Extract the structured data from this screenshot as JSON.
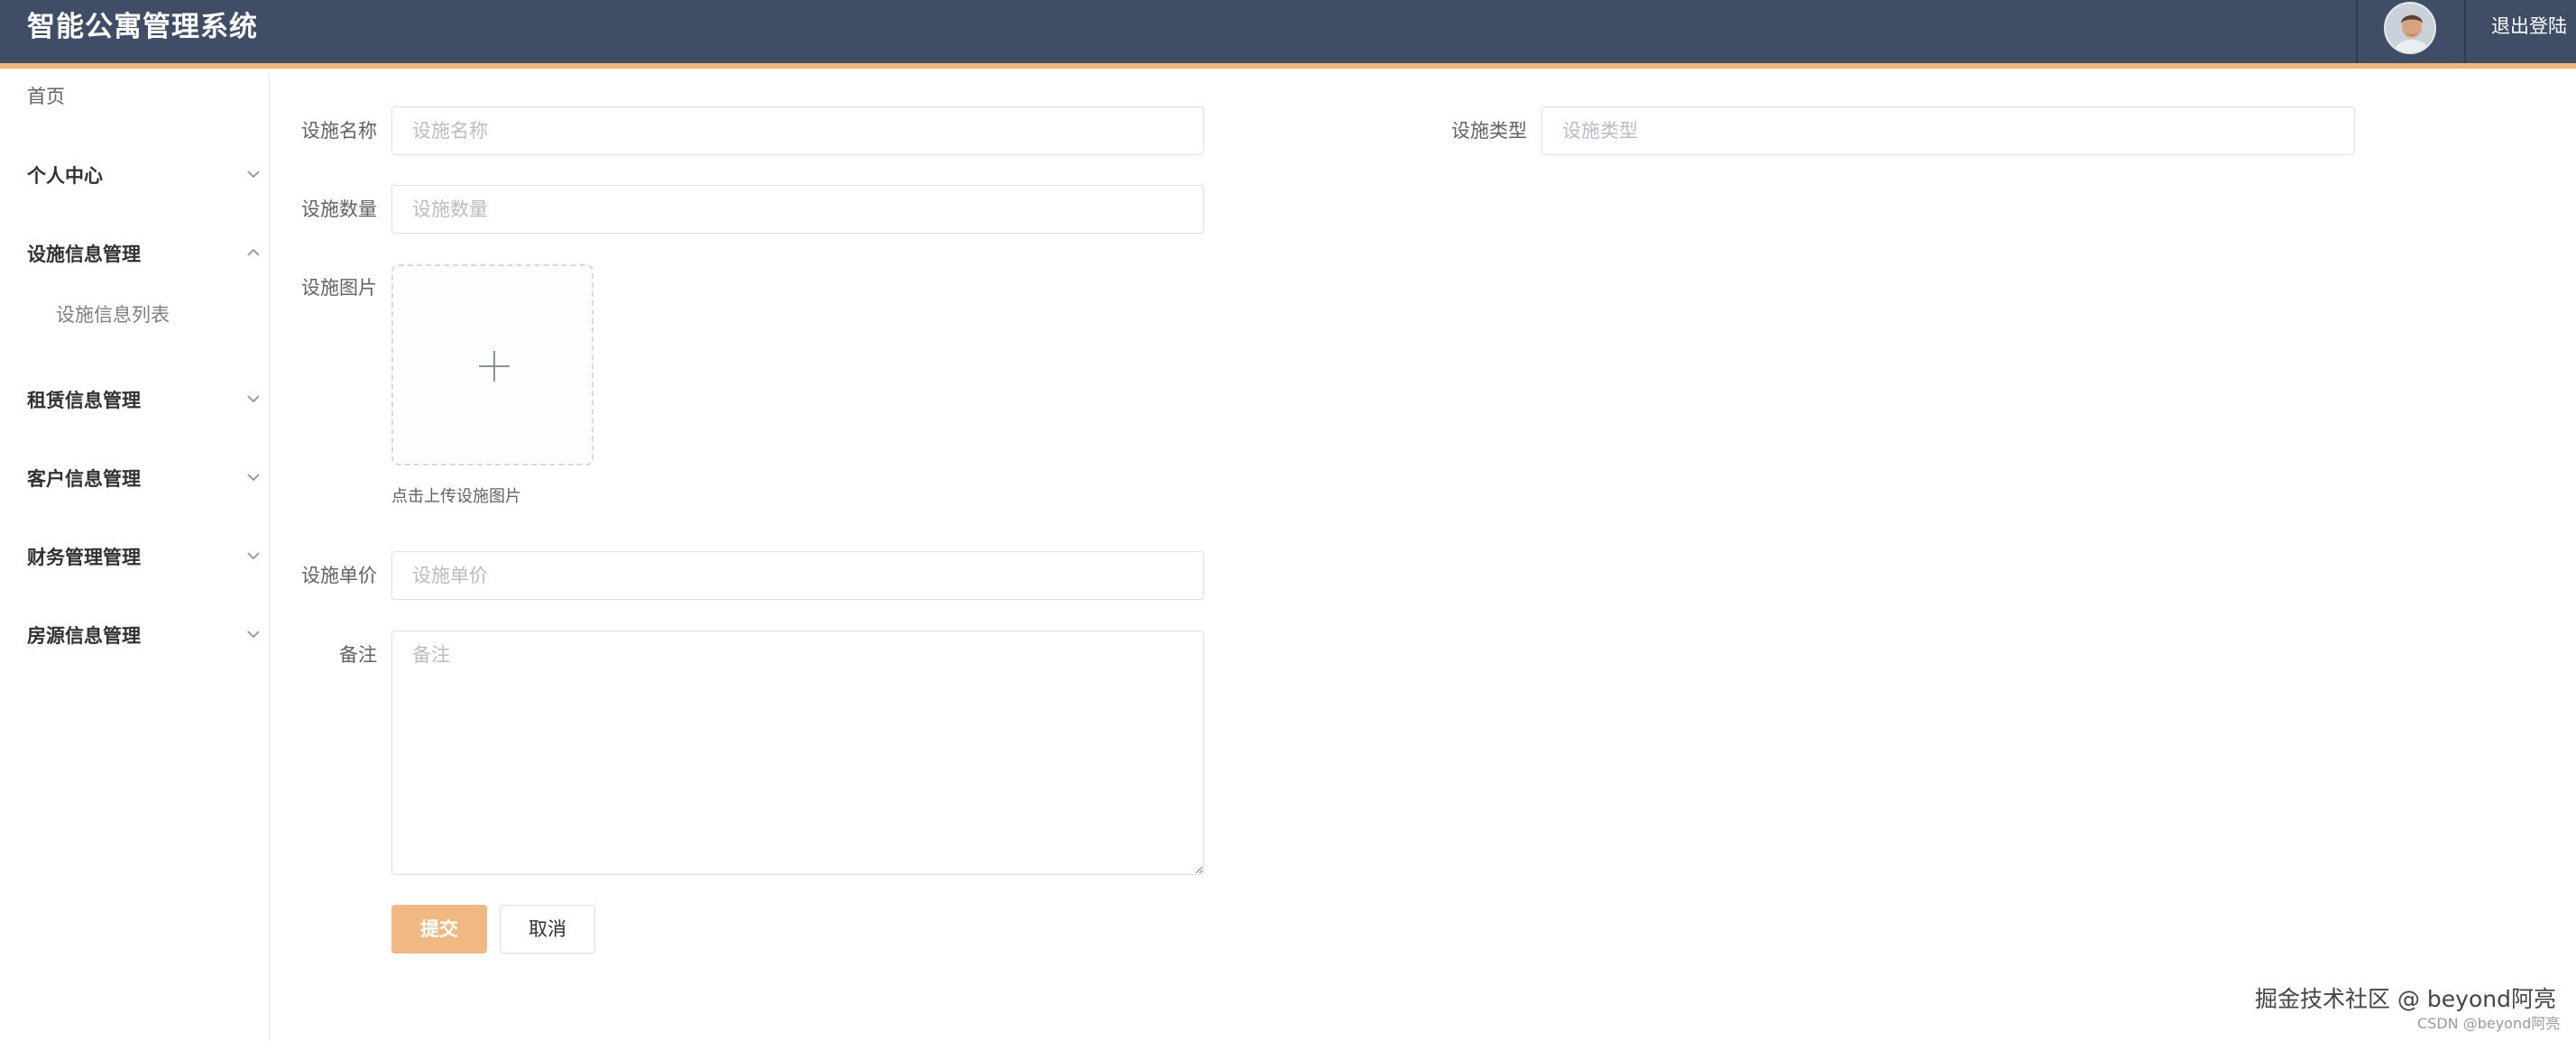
{
  "header": {
    "app_title": "智能公寓管理系统",
    "logout_label": "退出登陆",
    "brand_color": "#3f4d66",
    "accent_color": "#f0b47a"
  },
  "sidebar": {
    "home_label": "首页",
    "items": [
      {
        "label": "个人中心",
        "icon": "chevron-down-icon"
      },
      {
        "label": "设施信息管理",
        "icon": "chevron-up-icon",
        "expanded": true,
        "children": [
          {
            "label": "设施信息列表"
          }
        ]
      },
      {
        "label": "租赁信息管理",
        "icon": "chevron-down-icon"
      },
      {
        "label": "客户信息管理",
        "icon": "chevron-down-icon"
      },
      {
        "label": "财务管理管理",
        "icon": "chevron-down-icon"
      },
      {
        "label": "房源信息管理",
        "icon": "chevron-down-icon"
      }
    ]
  },
  "form": {
    "name": {
      "label": "设施名称",
      "placeholder": "设施名称",
      "value": ""
    },
    "type": {
      "label": "设施类型",
      "placeholder": "设施类型",
      "value": ""
    },
    "quantity": {
      "label": "设施数量",
      "placeholder": "设施数量",
      "value": ""
    },
    "image": {
      "label": "设施图片",
      "tip": "点击上传设施图片",
      "icon": "plus-icon"
    },
    "price": {
      "label": "设施单价",
      "placeholder": "设施单价",
      "value": ""
    },
    "remark": {
      "label": "备注",
      "placeholder": "备注",
      "value": ""
    },
    "submit_label": "提交",
    "cancel_label": "取消"
  },
  "watermark": {
    "line1": "掘金技术社区 @ beyond阿亮",
    "line2": "CSDN @beyond阿亮"
  }
}
